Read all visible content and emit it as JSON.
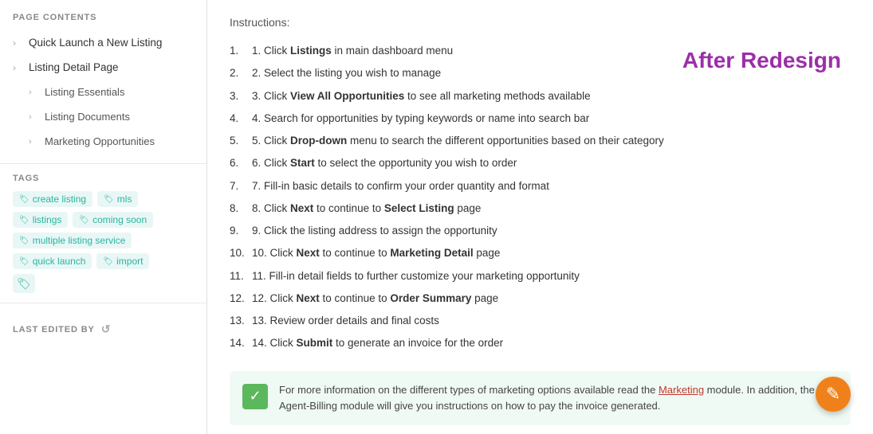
{
  "sidebar": {
    "page_contents_label": "PAGE CONTENTS",
    "nav_items": [
      {
        "id": "quick-launch",
        "label": "Quick Launch a New Listing",
        "level": 1
      },
      {
        "id": "listing-detail",
        "label": "Listing Detail Page",
        "level": 1
      },
      {
        "id": "listing-essentials",
        "label": "Listing Essentials",
        "level": 2
      },
      {
        "id": "listing-documents",
        "label": "Listing Documents",
        "level": 2
      },
      {
        "id": "marketing-opportunities",
        "label": "Marketing Opportunities",
        "level": 2
      }
    ],
    "tags_label": "TAGS",
    "tags": [
      {
        "id": "create-listing",
        "label": "create listing"
      },
      {
        "id": "mls",
        "label": "mls"
      },
      {
        "id": "listings",
        "label": "listings"
      },
      {
        "id": "coming-soon",
        "label": "coming soon"
      },
      {
        "id": "multiple-listing-service",
        "label": "multiple listing service"
      },
      {
        "id": "quick-launch",
        "label": "quick launch"
      },
      {
        "id": "import",
        "label": "import"
      }
    ],
    "last_edited_label": "LAST EDITED BY"
  },
  "main": {
    "instructions_label": "Instructions:",
    "after_redesign_heading": "After Redesign",
    "steps": [
      {
        "id": 1,
        "text": " in main dashboard menu",
        "bold": "Listings",
        "bold_pos": "start"
      },
      {
        "id": 2,
        "text": "Select the listing you wish to manage",
        "bold": "",
        "bold_pos": "none"
      },
      {
        "id": 3,
        "text": " to see all marketing methods available",
        "bold": "View All Opportunities",
        "bold_pos": "start"
      },
      {
        "id": 4,
        "text": "Search for opportunities by typing keywords or name into search bar",
        "bold": "",
        "bold_pos": "none"
      },
      {
        "id": 5,
        "text": " menu to search the different opportunities based on their category",
        "bold": "Drop-down",
        "bold_pos": "start"
      },
      {
        "id": 6,
        "text": " to select the opportunity you wish to order",
        "bold": "Start",
        "bold_pos": "start"
      },
      {
        "id": 7,
        "text": "Fill-in basic details to confirm your order quantity and format",
        "bold": "",
        "bold_pos": "none"
      },
      {
        "id": 8,
        "text": " to continue to  page",
        "bold": "Next",
        "bold_pos": "start",
        "bold2": "Select Listing",
        "bold2_pos": "mid"
      },
      {
        "id": 9,
        "text": "Click the listing address to assign the opportunity",
        "bold": "",
        "bold_pos": "none"
      },
      {
        "id": 10,
        "text": " to continue to  page",
        "bold": "Next",
        "bold_pos": "start",
        "bold2": "Marketing Detail",
        "bold2_pos": "mid"
      },
      {
        "id": 11,
        "text": "Fill-in detail fields to further customize your marketing opportunity",
        "bold": "",
        "bold_pos": "none"
      },
      {
        "id": 12,
        "text": " to continue to  page",
        "bold": "Next",
        "bold_pos": "start",
        "bold2": "Order Summary",
        "bold2_pos": "mid"
      },
      {
        "id": 13,
        "text": "Review order details and final costs",
        "bold": "",
        "bold_pos": "none"
      },
      {
        "id": 14,
        "text": " to generate an invoice for the order",
        "bold": "Submit",
        "bold_pos": "start"
      }
    ],
    "info_box": {
      "text_before": "For more information on the different types of marketing options available read the ",
      "link_text": "Marketing",
      "text_after": " module. In addition, the Agent-Billing module will give you instructions on how to pay the invoice generated."
    },
    "fab_label": "✎"
  }
}
